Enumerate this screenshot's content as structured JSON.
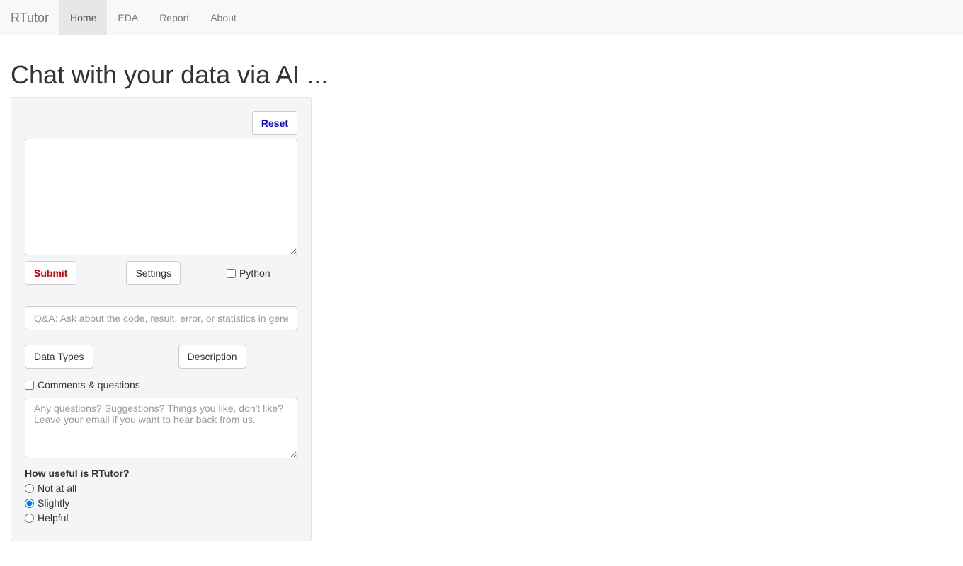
{
  "nav": {
    "brand": "RTutor",
    "items": [
      {
        "label": "Home",
        "active": true
      },
      {
        "label": "EDA",
        "active": false
      },
      {
        "label": "Report",
        "active": false
      },
      {
        "label": "About",
        "active": false
      }
    ]
  },
  "page": {
    "title": "Chat with your data via AI ..."
  },
  "panel": {
    "reset_label": "Reset",
    "main_textarea_value": "",
    "submit_label": "Submit",
    "settings_label": "Settings",
    "python_label": "Python",
    "python_checked": false,
    "qa_placeholder": "Q&A: Ask about the code, result, error, or statistics in general.",
    "qa_value": "",
    "data_types_label": "Data Types",
    "description_label": "Description",
    "comments_label": "Comments & questions",
    "comments_checked": false,
    "feedback_placeholder": "Any questions? Suggestions? Things you like, don't like? Leave your email if you want to hear back from us.",
    "feedback_value": "",
    "useful_label": "How useful is RTutor?",
    "useful_options": [
      {
        "label": "Not at all",
        "selected": false
      },
      {
        "label": "Slightly",
        "selected": true
      },
      {
        "label": "Helpful",
        "selected": false
      }
    ]
  }
}
